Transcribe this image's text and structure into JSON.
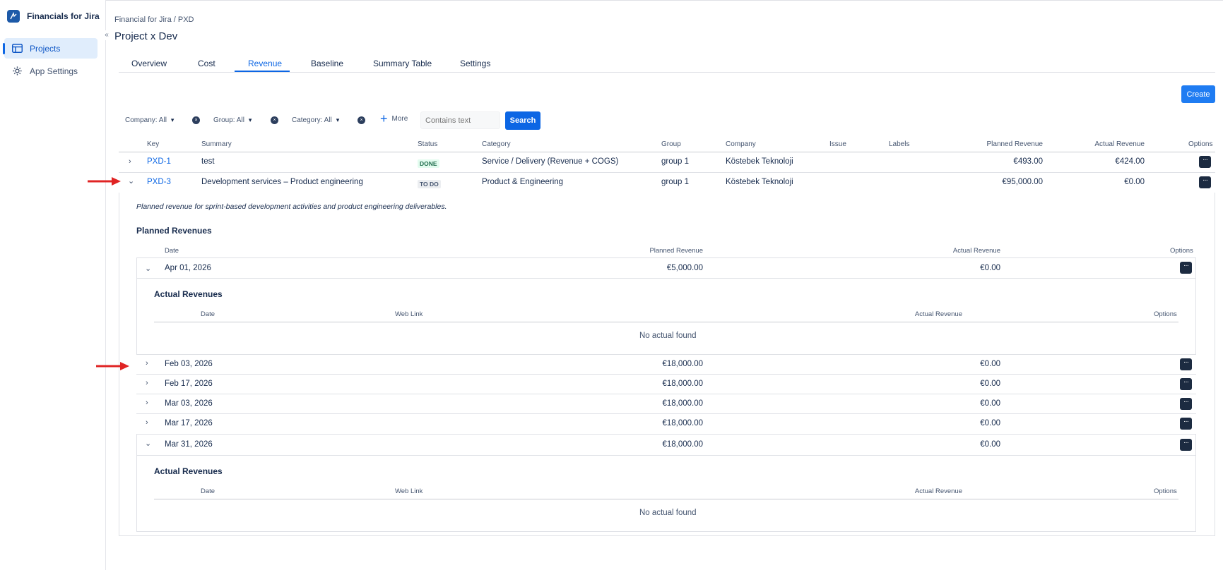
{
  "app": {
    "title": "Financials for Jira",
    "logo_icon": "brand-icon",
    "collapse_icon": "«"
  },
  "sidebar": {
    "items": [
      {
        "label": "Projects",
        "icon": "table-icon",
        "active": true
      },
      {
        "label": "App Settings",
        "icon": "gear-icon",
        "active": false
      }
    ]
  },
  "header": {
    "breadcrumb": "Financial for Jira  / PXD",
    "title": "Project x Dev"
  },
  "tabs": [
    "Overview",
    "Cost",
    "Revenue",
    "Baseline",
    "Summary Table",
    "Settings"
  ],
  "active_tab": "Revenue",
  "create_label": "Create",
  "filters": {
    "company": "Company: All",
    "group": "Group: All",
    "category": "Category: All",
    "more": "More",
    "search_placeholder": "Contains text",
    "search_label": "Search"
  },
  "table": {
    "headers": [
      "Key",
      "Summary",
      "Status",
      "Category",
      "Group",
      "Company",
      "Issue",
      "Labels",
      "Planned Revenue",
      "Actual Revenue",
      "Options"
    ],
    "rows": [
      {
        "key": "PXD-1",
        "summary": "test",
        "status": "DONE",
        "category": "Service / Delivery (Revenue + COGS)",
        "group": "group 1",
        "company": "Köstebek Teknoloji",
        "planned": "€493.00",
        "actual": "€424.00",
        "expanded": false
      },
      {
        "key": "PXD-3",
        "summary": "Development services – Product engineering",
        "status": "TO DO",
        "category": "Product & Engineering",
        "group": "group 1",
        "company": "Köstebek Teknoloji",
        "planned": "€95,000.00",
        "actual": "€0.00",
        "expanded": true
      }
    ]
  },
  "detail": {
    "description": "Planned revenue for sprint-based development activities and product engineering deliverables.",
    "planned_title": "Planned Revenues",
    "planned_headers": [
      "Date",
      "Planned Revenue",
      "Actual Revenue",
      "Options"
    ],
    "planned_rows": [
      {
        "date": "Apr 01, 2026",
        "planned": "€5,000.00",
        "actual": "€0.00",
        "expanded": true
      },
      {
        "date": "Feb 03, 2026",
        "planned": "€18,000.00",
        "actual": "€0.00",
        "expanded": false
      },
      {
        "date": "Feb 17, 2026",
        "planned": "€18,000.00",
        "actual": "€0.00",
        "expanded": false
      },
      {
        "date": "Mar 03, 2026",
        "planned": "€18,000.00",
        "actual": "€0.00",
        "expanded": false
      },
      {
        "date": "Mar 17, 2026",
        "planned": "€18,000.00",
        "actual": "€0.00",
        "expanded": false
      },
      {
        "date": "Mar 31, 2026",
        "planned": "€18,000.00",
        "actual": "€0.00",
        "expanded": true
      }
    ],
    "actual_title": "Actual Revenues",
    "actual_headers": [
      "Date",
      "Web Link",
      "Actual Revenue",
      "Options"
    ],
    "no_actual": "No actual found"
  },
  "glyphs": {
    "options": "···",
    "chev_right": "›",
    "chev_down": "⌄",
    "clear": "×",
    "plus": "+"
  },
  "colors": {
    "accent": "#0c66e4",
    "options_button": "#1c2b41",
    "annotation_arrow": "#e02424"
  }
}
